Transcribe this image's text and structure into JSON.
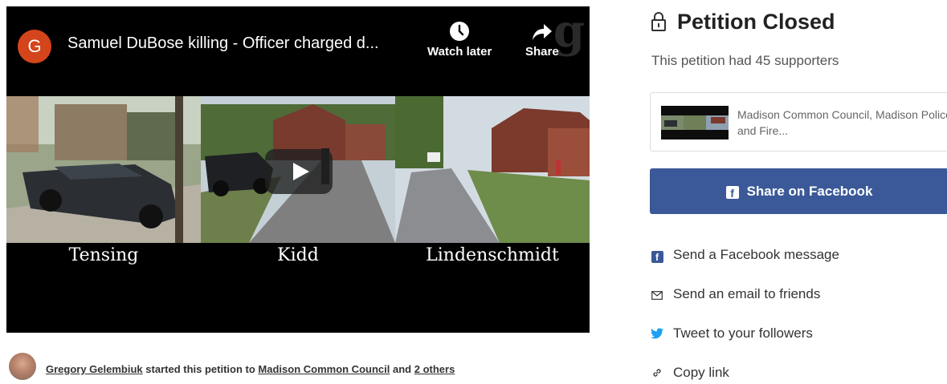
{
  "video": {
    "channel_initial": "G",
    "title": "Samuel DuBose killing - Officer charged d...",
    "watch_later_label": "Watch later",
    "share_label": "Share",
    "logo_letter": "g",
    "panels": [
      {
        "caption": "Tensing"
      },
      {
        "caption": "Kidd"
      },
      {
        "caption": "Lindenschmidt"
      }
    ]
  },
  "author": {
    "name": "Gregory Gelembiuk",
    "middle_text": "started this petition to",
    "target_link": "Madison Common Council",
    "and_text": "and",
    "others_link": "2 others"
  },
  "status": {
    "title": "Petition Closed",
    "supporters_text": "This petition had 45 supporters"
  },
  "target_card": {
    "text": "Madison Common Council, Madison Police and Fire..."
  },
  "share": {
    "facebook_button": "Share on Facebook",
    "options": [
      {
        "icon": "facebook-icon",
        "label": "Send a Facebook message"
      },
      {
        "icon": "email-icon",
        "label": "Send an email to friends"
      },
      {
        "icon": "twitter-icon",
        "label": "Tweet to your followers"
      },
      {
        "icon": "link-icon",
        "label": "Copy link"
      }
    ]
  },
  "colors": {
    "facebook_blue": "#3b5998",
    "twitter_blue": "#1da1f2",
    "channel_avatar": "#d4451b"
  }
}
